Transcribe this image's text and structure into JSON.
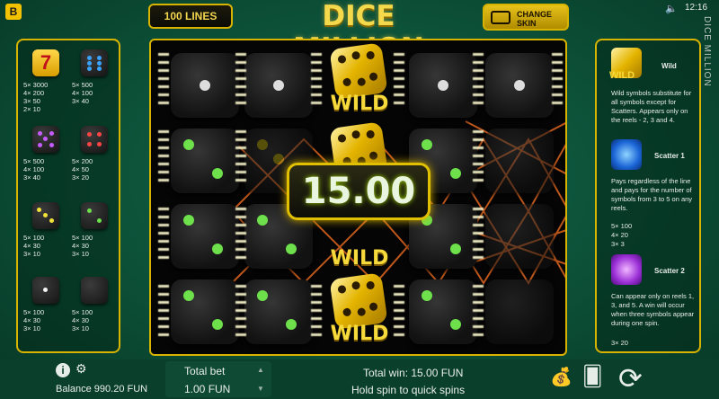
{
  "header": {
    "brand": "B",
    "lines_label": "100 LINES",
    "title": "DICE MILLION",
    "skin_label_1": "CHANGE",
    "skin_label_2": "SKIN",
    "clock": "12:16",
    "side_title": "DICE MILLION"
  },
  "paytable": [
    {
      "symbol": "seven",
      "pays": [
        "5× 3000",
        "4× 200",
        "3× 50",
        "2× 10"
      ]
    },
    {
      "symbol": "blue-dice",
      "pays": [
        "5× 500",
        "4× 100",
        "3× 40"
      ]
    },
    {
      "symbol": "purple-dice",
      "pays": [
        "5× 500",
        "4× 100",
        "3× 40"
      ]
    },
    {
      "symbol": "red-dice",
      "pays": [
        "5× 200",
        "4× 50",
        "3× 20"
      ]
    },
    {
      "symbol": "yellow-dice",
      "pays": [
        "5× 100",
        "4× 30",
        "3× 10"
      ]
    },
    {
      "symbol": "green-dice",
      "pays": [
        "5× 100",
        "4× 30",
        "3× 10"
      ]
    },
    {
      "symbol": "white-dice",
      "pays": [
        "5× 100",
        "4× 30",
        "3× 10"
      ]
    },
    {
      "symbol": "black-dice",
      "pays": [
        "5× 100",
        "4× 30",
        "3× 10"
      ]
    }
  ],
  "reels": {
    "wild_label": "WILD",
    "win_amount": "15.00"
  },
  "info": {
    "wild_icon_label": "WILD",
    "wild_title": "Wild",
    "wild_text": "Wild symbols substitute for all symbols except for Scatters. Appears only on the reels - 2, 3 and 4.",
    "scatter1_title": "Scatter 1",
    "scatter1_text": "Pays regardless of the line and pays for the number of symbols from 3 to 5 on any reels.",
    "scatter1_pays": [
      "5× 100",
      "4× 20",
      "3× 3"
    ],
    "scatter2_title": "Scatter 2",
    "scatter2_text": "Can appear only on reels 1, 3, and 5. A win will occur when three symbols appear during one spin.",
    "scatter2_pays": [
      "3× 20"
    ]
  },
  "footer": {
    "balance": "Balance 990.20 FUN",
    "total_bet_label": "Total bet",
    "total_bet_value": "1.00 FUN",
    "total_win": "Total win: 15.00 FUN",
    "hint": "Hold spin to quick spins"
  }
}
